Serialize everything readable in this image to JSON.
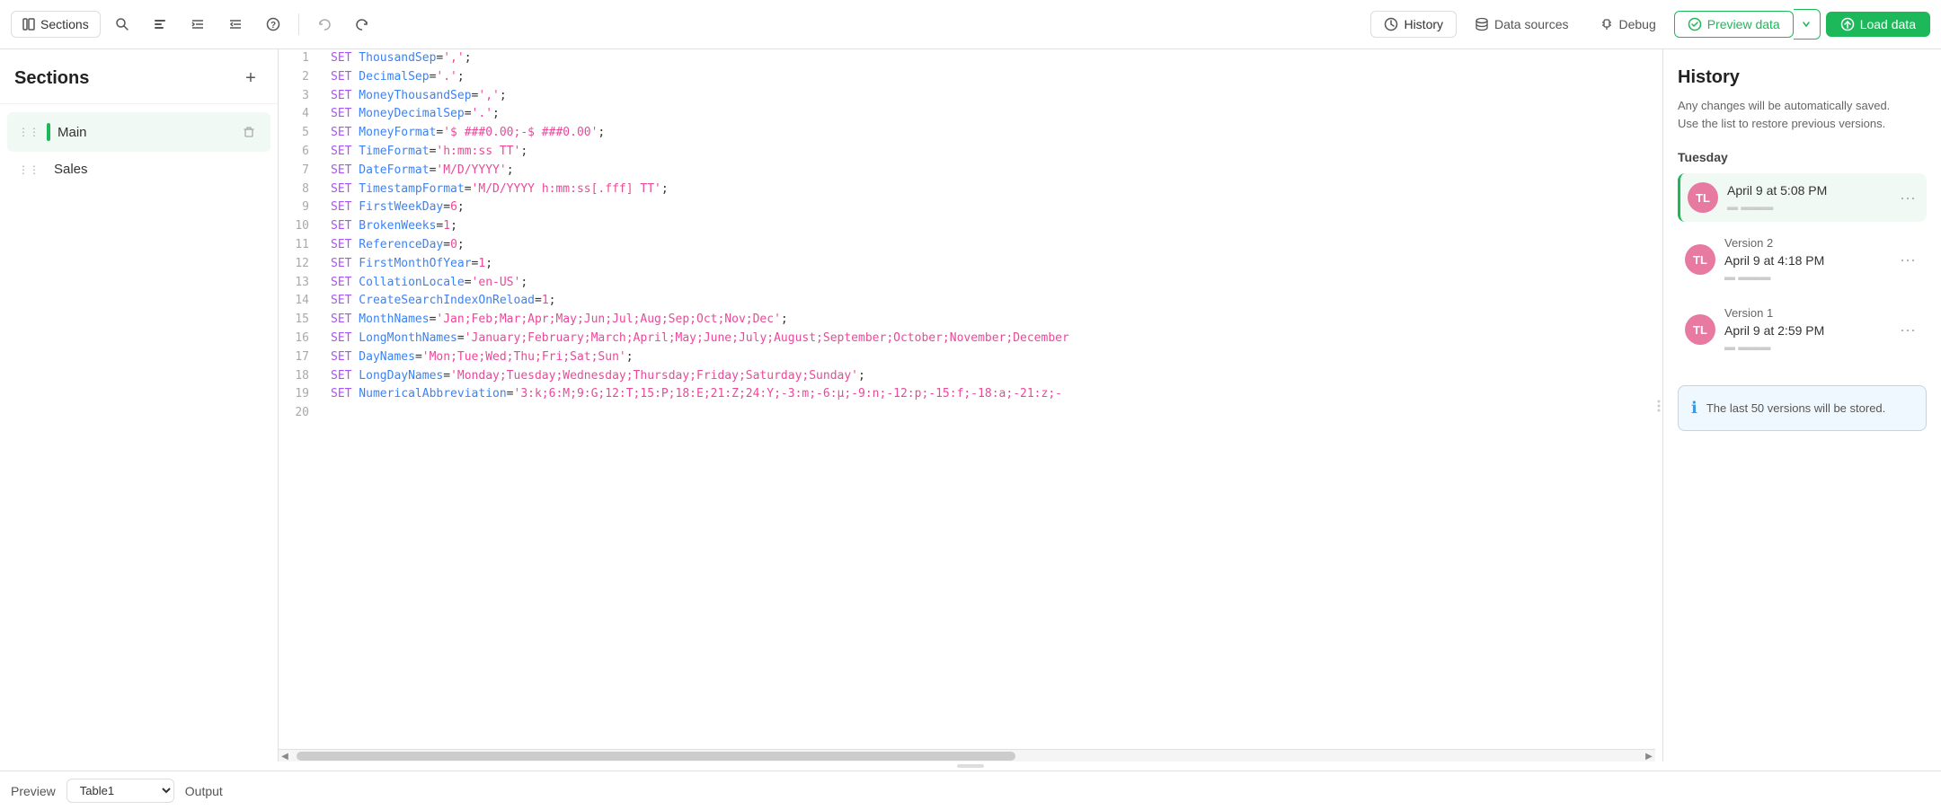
{
  "toolbar": {
    "sections_label": "Sections",
    "history_label": "History",
    "datasources_label": "Data sources",
    "debug_label": "Debug",
    "preview_data_label": "Preview data",
    "load_data_label": "Load data"
  },
  "sidebar": {
    "title": "Sections",
    "add_tooltip": "+",
    "items": [
      {
        "id": "main",
        "label": "Main",
        "active": true
      },
      {
        "id": "sales",
        "label": "Sales",
        "active": false
      }
    ]
  },
  "editor": {
    "lines": [
      {
        "num": 1,
        "code": "SET ThousandSep=',';",
        "tokens": [
          {
            "t": "kw",
            "v": "SET"
          },
          {
            "t": "key",
            "v": " ThousandSep"
          },
          {
            "t": "plain",
            "v": "="
          },
          {
            "t": "val",
            "v": "','"
          },
          {
            "t": "plain",
            "v": ";"
          }
        ]
      },
      {
        "num": 2,
        "code": "SET DecimalSep='.';",
        "tokens": [
          {
            "t": "kw",
            "v": "SET"
          },
          {
            "t": "key",
            "v": " DecimalSep"
          },
          {
            "t": "plain",
            "v": "="
          },
          {
            "t": "val",
            "v": "'.'"
          },
          {
            "t": "plain",
            "v": ";"
          }
        ]
      },
      {
        "num": 3,
        "code": "SET MoneyThousandSep=',';",
        "tokens": [
          {
            "t": "kw",
            "v": "SET"
          },
          {
            "t": "key",
            "v": " MoneyThousandSep"
          },
          {
            "t": "plain",
            "v": "="
          },
          {
            "t": "val",
            "v": "','"
          },
          {
            "t": "plain",
            "v": ";"
          }
        ]
      },
      {
        "num": 4,
        "code": "SET MoneyDecimalSep='.';",
        "tokens": [
          {
            "t": "kw",
            "v": "SET"
          },
          {
            "t": "key",
            "v": " MoneyDecimalSep"
          },
          {
            "t": "plain",
            "v": "="
          },
          {
            "t": "val",
            "v": "'.'"
          },
          {
            "t": "plain",
            "v": ";"
          }
        ]
      },
      {
        "num": 5,
        "code": "SET MoneyFormat='$ ###0.00;-$ ###0.00';",
        "tokens": [
          {
            "t": "kw",
            "v": "SET"
          },
          {
            "t": "key",
            "v": " MoneyFormat"
          },
          {
            "t": "plain",
            "v": "="
          },
          {
            "t": "val",
            "v": "'$ ###0.00;-$ ###0.00'"
          },
          {
            "t": "plain",
            "v": ";"
          }
        ]
      },
      {
        "num": 6,
        "code": "SET TimeFormat='h:mm:ss TT';",
        "tokens": [
          {
            "t": "kw",
            "v": "SET"
          },
          {
            "t": "key",
            "v": " TimeFormat"
          },
          {
            "t": "plain",
            "v": "="
          },
          {
            "t": "val",
            "v": "'h:mm:ss TT'"
          },
          {
            "t": "plain",
            "v": ";"
          }
        ]
      },
      {
        "num": 7,
        "code": "SET DateFormat='M/D/YYYY';",
        "tokens": [
          {
            "t": "kw",
            "v": "SET"
          },
          {
            "t": "key",
            "v": " DateFormat"
          },
          {
            "t": "plain",
            "v": "="
          },
          {
            "t": "val",
            "v": "'M/D/YYYY'"
          },
          {
            "t": "plain",
            "v": ";"
          }
        ]
      },
      {
        "num": 8,
        "code": "SET TimestampFormat='M/D/YYYY h:mm:ss[.fff] TT';",
        "tokens": [
          {
            "t": "kw",
            "v": "SET"
          },
          {
            "t": "key",
            "v": " TimestampFormat"
          },
          {
            "t": "plain",
            "v": "="
          },
          {
            "t": "val",
            "v": "'M/D/YYYY h:mm:ss[.fff] TT'"
          },
          {
            "t": "plain",
            "v": ";"
          }
        ]
      },
      {
        "num": 9,
        "code": "SET FirstWeekDay=6;",
        "tokens": [
          {
            "t": "kw",
            "v": "SET"
          },
          {
            "t": "key",
            "v": " FirstWeekDay"
          },
          {
            "t": "plain",
            "v": "="
          },
          {
            "t": "val",
            "v": "6"
          },
          {
            "t": "plain",
            "v": ";"
          }
        ]
      },
      {
        "num": 10,
        "code": "SET BrokenWeeks=1;",
        "tokens": [
          {
            "t": "kw",
            "v": "SET"
          },
          {
            "t": "key",
            "v": " BrokenWeeks"
          },
          {
            "t": "plain",
            "v": "="
          },
          {
            "t": "val",
            "v": "1"
          },
          {
            "t": "plain",
            "v": ";"
          }
        ]
      },
      {
        "num": 11,
        "code": "SET ReferenceDay=0;",
        "tokens": [
          {
            "t": "kw",
            "v": "SET"
          },
          {
            "t": "key",
            "v": " ReferenceDay"
          },
          {
            "t": "plain",
            "v": "="
          },
          {
            "t": "val",
            "v": "0"
          },
          {
            "t": "plain",
            "v": ";"
          }
        ]
      },
      {
        "num": 12,
        "code": "SET FirstMonthOfYear=1;",
        "tokens": [
          {
            "t": "kw",
            "v": "SET"
          },
          {
            "t": "key",
            "v": " FirstMonthOfYear"
          },
          {
            "t": "plain",
            "v": "="
          },
          {
            "t": "val",
            "v": "1"
          },
          {
            "t": "plain",
            "v": ";"
          }
        ]
      },
      {
        "num": 13,
        "code": "SET CollationLocale='en-US';",
        "tokens": [
          {
            "t": "kw",
            "v": "SET"
          },
          {
            "t": "key",
            "v": " CollationLocale"
          },
          {
            "t": "plain",
            "v": "="
          },
          {
            "t": "val",
            "v": "'en-US'"
          },
          {
            "t": "plain",
            "v": ";"
          }
        ]
      },
      {
        "num": 14,
        "code": "SET CreateSearchIndexOnReload=1;",
        "tokens": [
          {
            "t": "kw",
            "v": "SET"
          },
          {
            "t": "key",
            "v": " CreateSearchIndexOnReload"
          },
          {
            "t": "plain",
            "v": "="
          },
          {
            "t": "val",
            "v": "1"
          },
          {
            "t": "plain",
            "v": ";"
          }
        ]
      },
      {
        "num": 15,
        "code": "SET MonthNames='Jan;Feb;Mar;Apr;May;Jun;Jul;Aug;Sep;Oct;Nov;Dec';",
        "tokens": [
          {
            "t": "kw",
            "v": "SET"
          },
          {
            "t": "key",
            "v": " MonthNames"
          },
          {
            "t": "plain",
            "v": "="
          },
          {
            "t": "val",
            "v": "'Jan;Feb;Mar;Apr;May;Jun;Jul;Aug;Sep;Oct;Nov;Dec'"
          },
          {
            "t": "plain",
            "v": ";"
          }
        ]
      },
      {
        "num": 16,
        "code": "SET LongMonthNames='January;February;March;April;May;June;July;August;September;October;November;December",
        "tokens": [
          {
            "t": "kw",
            "v": "SET"
          },
          {
            "t": "key",
            "v": " LongMonthNames"
          },
          {
            "t": "plain",
            "v": "="
          },
          {
            "t": "val",
            "v": "'January;February;March;April;May;June;July;August;September;October;November;December"
          }
        ]
      },
      {
        "num": 17,
        "code": "SET DayNames='Mon;Tue;Wed;Thu;Fri;Sat;Sun';",
        "tokens": [
          {
            "t": "kw",
            "v": "SET"
          },
          {
            "t": "key",
            "v": " DayNames"
          },
          {
            "t": "plain",
            "v": "="
          },
          {
            "t": "val",
            "v": "'Mon;Tue;Wed;Thu;Fri;Sat;Sun'"
          },
          {
            "t": "plain",
            "v": ";"
          }
        ]
      },
      {
        "num": 18,
        "code": "SET LongDayNames='Monday;Tuesday;Wednesday;Thursday;Friday;Saturday;Sunday';",
        "tokens": [
          {
            "t": "kw",
            "v": "SET"
          },
          {
            "t": "key",
            "v": " LongDayNames"
          },
          {
            "t": "plain",
            "v": "="
          },
          {
            "t": "val",
            "v": "'Monday;Tuesday;Wednesday;Thursday;Friday;Saturday;Sunday'"
          },
          {
            "t": "plain",
            "v": ";"
          }
        ]
      },
      {
        "num": 19,
        "code": "SET NumericalAbbreviation='3:k;6:M;9:G;12:T;15:P;18:E;21:Z;24:Y;-3:m;-6:μ;-9:n;-12:p;-15:f;-18:a;-21:z;-",
        "tokens": [
          {
            "t": "kw",
            "v": "SET"
          },
          {
            "t": "key",
            "v": " NumericalAbbreviation"
          },
          {
            "t": "plain",
            "v": "="
          },
          {
            "t": "val",
            "v": "'3:k;6:M;9:G;12:T;15:P;18:E;21:Z;24:Y;-3:m;-6:μ;-9:n;-12:p;-15:f;-18:a;-21:z;-"
          }
        ]
      },
      {
        "num": 20,
        "code": "",
        "tokens": []
      }
    ]
  },
  "history": {
    "title": "History",
    "subtitle_line1": "Any changes will be automatically saved.",
    "subtitle_line2": "Use the list to restore previous versions.",
    "day_label": "Tuesday",
    "versions": [
      {
        "id": "current",
        "avatar_initials": "TL",
        "time": "April 9 at 5:08 PM",
        "preview_blocks": "▬ ▬▬",
        "active": true,
        "version_label": ""
      },
      {
        "id": "v2",
        "avatar_initials": "TL",
        "time": "April 9 at 4:18 PM",
        "preview_blocks": "▬ ▬▬",
        "active": false,
        "version_label": "Version 2"
      },
      {
        "id": "v1",
        "avatar_initials": "TL",
        "time": "April 9 at 2:59 PM",
        "preview_blocks": "▬ ▬▬",
        "active": false,
        "version_label": "Version 1"
      }
    ],
    "info_text": "The last 50 versions will be stored."
  },
  "bottom_bar": {
    "preview_label": "Preview",
    "table_placeholder": "Table1",
    "output_label": "Output"
  },
  "colors": {
    "accent_green": "#1cb85a",
    "avatar_pink": "#e879a0",
    "keyword_purple": "#a855f7",
    "key_blue": "#3b82f6",
    "value_pink": "#ec4899"
  }
}
